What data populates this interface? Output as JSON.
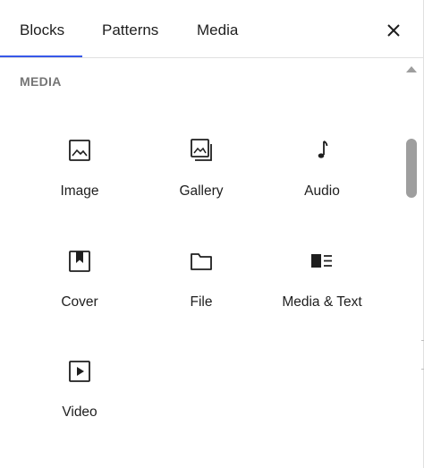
{
  "tabs": [
    {
      "label": "Blocks",
      "selected": true
    },
    {
      "label": "Patterns"
    },
    {
      "label": "Media"
    }
  ],
  "close_icon": "close-icon",
  "section_title": "MEDIA",
  "blocks": [
    {
      "label": "Image",
      "icon": "image-icon"
    },
    {
      "label": "Gallery",
      "icon": "gallery-icon"
    },
    {
      "label": "Audio",
      "icon": "audio-icon"
    },
    {
      "label": "Cover",
      "icon": "cover-icon"
    },
    {
      "label": "File",
      "icon": "file-icon"
    },
    {
      "label": "Media & Text",
      "icon": "media-text-icon"
    },
    {
      "label": "Video",
      "icon": "video-icon"
    }
  ],
  "colors": {
    "accent": "#3858e9",
    "text": "#1e1e1e",
    "muted": "#757575",
    "border": "#e0e0e0"
  }
}
